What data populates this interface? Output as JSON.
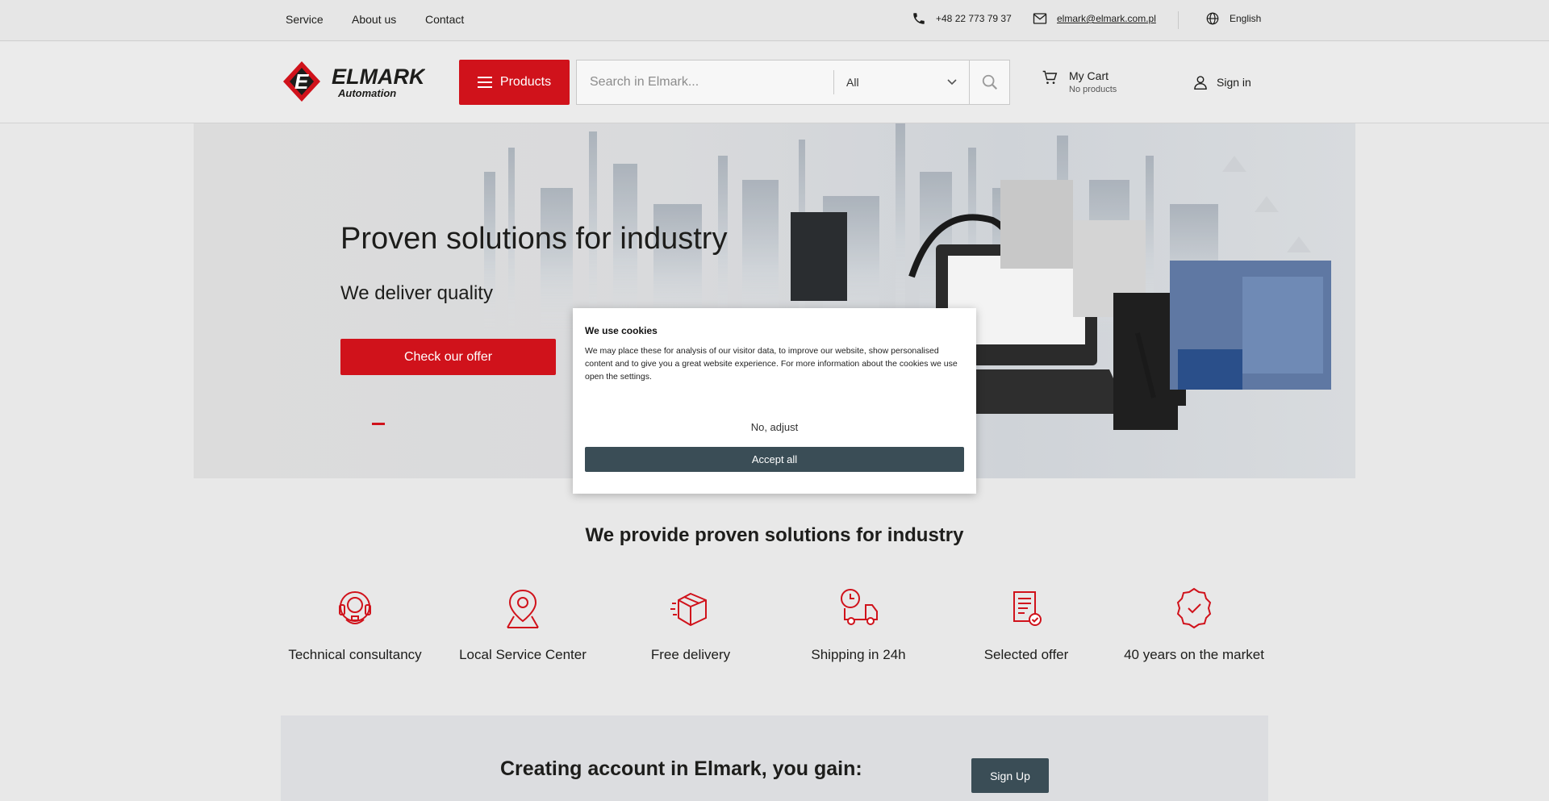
{
  "topbar": {
    "links": [
      "Service",
      "About us",
      "Contact"
    ],
    "phone": "+48 22 773 79 37",
    "email": "elmark@elmark.com.pl",
    "language": "English"
  },
  "header": {
    "logo_text": "ELMARK",
    "logo_sub": "Automation",
    "products_label": "Products",
    "search_placeholder": "Search in Elmark...",
    "category_value": "All",
    "cart_title": "My Cart",
    "cart_status": "No products",
    "signin_label": "Sign in"
  },
  "hero": {
    "title": "Proven solutions for industry",
    "subtitle": "We deliver quality",
    "cta_label": "Check our offer"
  },
  "cookie": {
    "title": "We use cookies",
    "text": "We may place these for analysis of our visitor data, to improve our website, show personalised content and to give you a great website experience. For more information about the cookies we use open the settings.",
    "adjust_label": "No, adjust",
    "accept_label": "Accept all"
  },
  "features": {
    "title": "We provide proven solutions for industry",
    "items": [
      {
        "label": "Technical consultancy",
        "icon": "headset-icon"
      },
      {
        "label": "Local Service Center",
        "icon": "location-pin-icon"
      },
      {
        "label": "Free delivery",
        "icon": "package-icon"
      },
      {
        "label": "Shipping in 24h",
        "icon": "delivery-truck-clock-icon"
      },
      {
        "label": "Selected offer",
        "icon": "document-check-icon"
      },
      {
        "label": "40 years on the market",
        "icon": "award-badge-icon"
      }
    ]
  },
  "account": {
    "title": "Creating account in Elmark, you gain:",
    "signup_label": "Sign Up"
  },
  "colors": {
    "brand_red": "#d0121b",
    "dark_button": "#3a4d56"
  }
}
